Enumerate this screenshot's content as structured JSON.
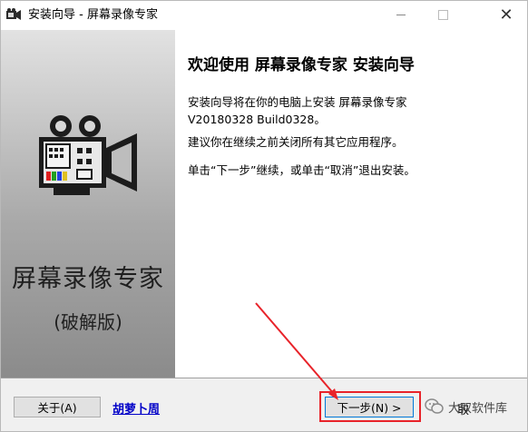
{
  "window": {
    "title": "安装向导 - 屏幕录像专家",
    "close_glyph": "✕"
  },
  "banner": {
    "title": "屏幕录像专家",
    "subtitle": "(破解版)"
  },
  "content": {
    "heading": "欢迎使用 屏幕录像专家 安装向导",
    "para1_line1": "安装向导将在你的电脑上安装 屏幕录像专家",
    "para1_line2": "V20180328 Build0328。",
    "para2": "建议你在继续之前关闭所有其它应用程序。",
    "para3": "单击“下一步”继续，或单击“取消”退出安装。"
  },
  "footer": {
    "about_label": "关于(A)",
    "link_text": "胡萝卜周",
    "next_label": "下一步(N) >",
    "cancel_partial": "取",
    "watermark_text": "大双软件库"
  },
  "colors": {
    "highlight": "#e8232a",
    "link": "#0000c8",
    "accent_border": "#0078d7"
  },
  "icons": {
    "app": "camera-app-icon",
    "minimize": "minimize-icon",
    "maximize": "maximize-icon",
    "close": "close-icon",
    "banner_art": "video-camera-icon",
    "watermark": "wechat-icon"
  }
}
